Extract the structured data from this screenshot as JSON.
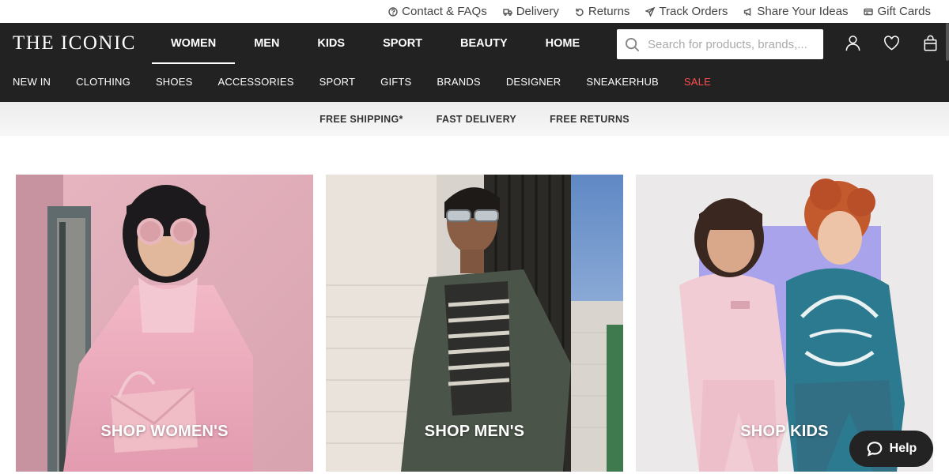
{
  "utility": {
    "links": [
      {
        "label": "Contact & FAQs",
        "icon": "help-circle-icon"
      },
      {
        "label": "Delivery",
        "icon": "truck-icon"
      },
      {
        "label": "Returns",
        "icon": "return-arrow-icon"
      },
      {
        "label": "Track Orders",
        "icon": "send-icon"
      },
      {
        "label": "Share Your Ideas",
        "icon": "megaphone-icon"
      },
      {
        "label": "Gift Cards",
        "icon": "gift-card-icon"
      }
    ]
  },
  "header": {
    "logo": "THE ICONIC",
    "departments": [
      "WOMEN",
      "MEN",
      "KIDS",
      "SPORT",
      "BEAUTY",
      "HOME"
    ],
    "active_department": "WOMEN",
    "search": {
      "placeholder": "Search for products, brands,..."
    },
    "icons": [
      "account-icon",
      "wishlist-heart-icon",
      "shopping-bag-icon"
    ],
    "categories": [
      "NEW IN",
      "CLOTHING",
      "SHOES",
      "ACCESSORIES",
      "SPORT",
      "GIFTS",
      "BRANDS",
      "DESIGNER",
      "SNEAKERHUB",
      "SALE"
    ]
  },
  "promo": [
    "FREE SHIPPING*",
    "FAST DELIVERY",
    "FREE RETURNS"
  ],
  "tiles": [
    {
      "label": "SHOP WOMEN'S"
    },
    {
      "label": "SHOP MEN'S"
    },
    {
      "label": "SHOP KIDS"
    }
  ],
  "help": {
    "label": "Help",
    "icon": "chat-bubble-icon"
  },
  "colors": {
    "header_bg": "#222222",
    "sale": "#ff4d4d",
    "promo_bg": "#efefef"
  }
}
